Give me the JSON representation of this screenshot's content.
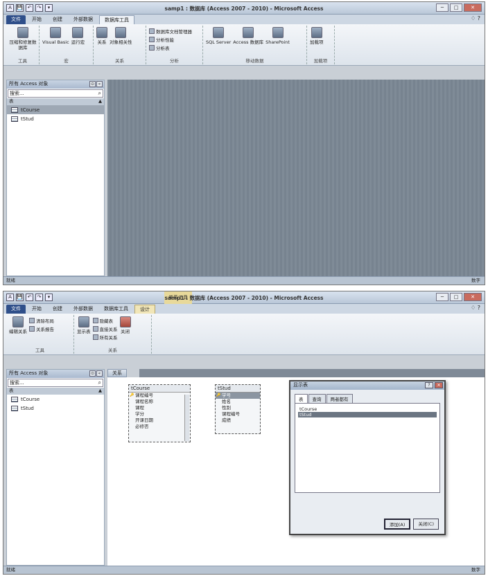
{
  "shot1": {
    "title": "samp1 : 数据库 (Access 2007 - 2010) - Microsoft Access",
    "window_buttons": [
      "─",
      "□",
      "✕"
    ],
    "qat": [
      "A",
      "💾",
      "↶",
      "↷",
      "▾"
    ],
    "tabs": [
      "文件",
      "开始",
      "创建",
      "外部数据",
      "数据库工具"
    ],
    "active_tab": "数据库工具",
    "help": "♢ ?",
    "ribbon": {
      "groups": [
        {
          "label": "工具",
          "buttons": [
            "压缩和修复数据库"
          ]
        },
        {
          "label": "宏",
          "buttons": [
            "Visual Basic",
            "运行宏"
          ]
        },
        {
          "label": "关系",
          "buttons": [
            "关系",
            "对象相关性"
          ]
        },
        {
          "label": "分析",
          "small": [
            "数据库文档管理器",
            "分析性能",
            "分析表"
          ]
        },
        {
          "label": "移动数据",
          "buttons": [
            "SQL Server",
            "Access 数据库",
            "SharePoint"
          ]
        },
        {
          "label": "加载项",
          "buttons": [
            "加载项"
          ]
        }
      ]
    },
    "nav": {
      "header": "所有 Access 对象",
      "header_buttons": [
        "⊙",
        "«"
      ],
      "search_placeholder": "搜索...",
      "search_icon": "⌕",
      "group": "表",
      "group_chevron": "▲",
      "items": [
        "tCourse",
        "tStud"
      ]
    },
    "status_left": "就绪",
    "status_right": "数字"
  },
  "shot2": {
    "title": "samp1 : 数据库 (Access 2007 - 2010) - Microsoft Access",
    "context_tab_title": "关系工具",
    "window_buttons": [
      "─",
      "□",
      "✕"
    ],
    "qat": [
      "A",
      "💾",
      "↶",
      "↷",
      "▾"
    ],
    "tabs": [
      "文件",
      "开始",
      "创建",
      "外部数据",
      "数据库工具",
      "设计"
    ],
    "active_tab": "设计",
    "help": "♢ ?",
    "ribbon": {
      "groups": [
        {
          "label": "工具",
          "buttons": [
            "编辑关系"
          ],
          "small": [
            "清除布局",
            "关系报告"
          ]
        },
        {
          "label": "关系",
          "buttons": [
            "显示表",
            "关闭"
          ],
          "small": [
            "隐藏表",
            "直接关系",
            "所有关系"
          ]
        }
      ]
    },
    "nav": {
      "header": "所有 Access 对象",
      "header_buttons": [
        "⊙",
        "«"
      ],
      "search_placeholder": "搜索...",
      "search_icon": "⌕",
      "group": "表",
      "group_chevron": "▲",
      "items": [
        "tCourse",
        "tStud"
      ]
    },
    "doc_tab": "关系",
    "tables": [
      {
        "name": "tCourse",
        "fields": [
          "课程编号",
          "课程名称",
          "课程",
          "学分",
          "开课日期",
          "必修否"
        ],
        "key_index": 0,
        "highlight_index": -1
      },
      {
        "name": "tStud",
        "fields": [
          "学号",
          "姓名",
          "性别",
          "课程编号",
          "成绩"
        ],
        "key_index": 0,
        "highlight_index": 0
      }
    ],
    "dialog": {
      "title": "显示表",
      "title_buttons": [
        "?",
        "✕"
      ],
      "tabs": [
        "表",
        "查询",
        "两者都有"
      ],
      "active_tab": "表",
      "list": [
        "tCourse",
        "tStud"
      ],
      "selected_index": 1,
      "buttons": [
        "添加(A)",
        "关闭(C)"
      ]
    },
    "status_left": "就绪",
    "status_right": "数字"
  }
}
